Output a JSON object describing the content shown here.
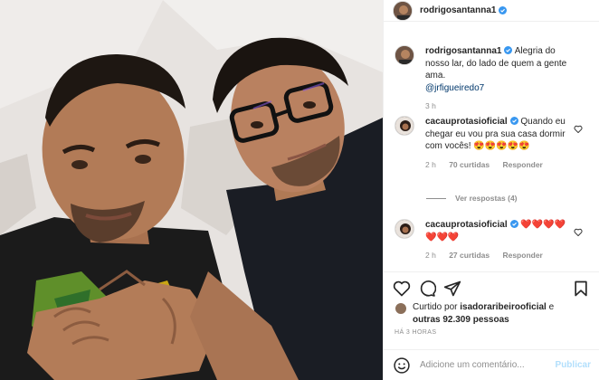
{
  "header": {
    "username": "rodrigosantanna1",
    "verified": true
  },
  "caption": {
    "username": "rodrigosantanna1",
    "text": " Alegria do nosso lar, do lado de quem a gente ama.",
    "mention": "@jrfigueiredo7",
    "age": "3 h"
  },
  "comments": [
    {
      "username": "cacauprotasioficial",
      "text": " Quando eu chegar eu vou pra sua casa dormir com vocês! 😍😍😍😍😍",
      "age": "2 h",
      "likes": "70 curtidas",
      "reply": "Responder"
    },
    {
      "username": "cacauprotasioficial",
      "text": " ❤️❤️❤️❤️❤️❤️❤️",
      "age": "2 h",
      "likes": "27 curtidas",
      "reply": "Responder"
    }
  ],
  "view_replies": "Ver respostas (4)",
  "liked_by": {
    "prefix": "Curtido por ",
    "user": "isadoraribeirooficial",
    "mid": " e",
    "others": "outras 92.309 pessoas"
  },
  "timestamp": "HÁ 3 HORAS",
  "comment_box": {
    "placeholder": "Adicione um comentário...",
    "publish": "Publicar"
  },
  "icons": {
    "like": "heart-icon",
    "comment": "comment-icon",
    "share": "share-icon",
    "save": "bookmark-icon",
    "emoji": "emoji-icon",
    "verified": "verified-badge-icon"
  },
  "colors": {
    "verified": "#3897f0",
    "link": "#00376b",
    "muted": "#8e8e8e",
    "publish": "#b2dffc"
  }
}
